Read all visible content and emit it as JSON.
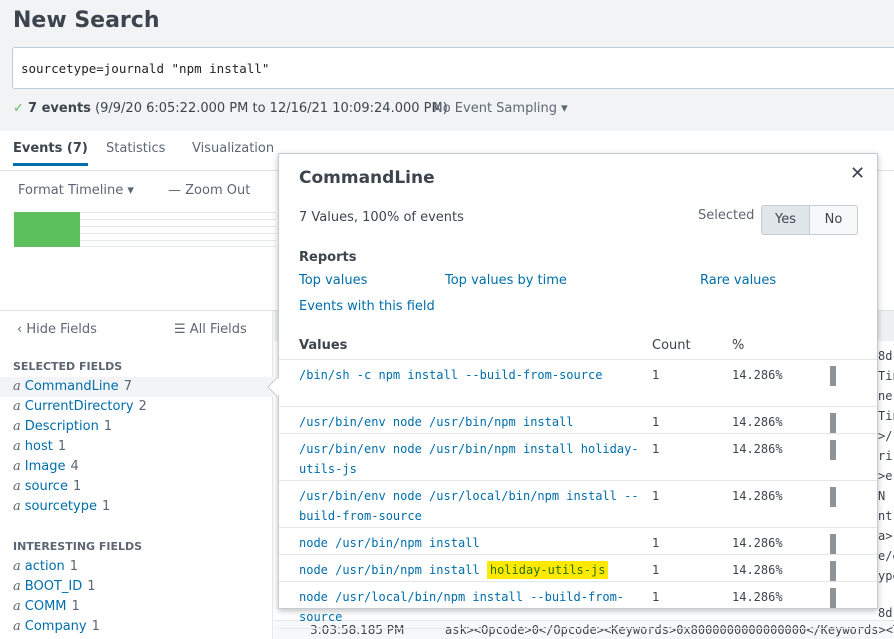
{
  "header": {
    "title": "New Search",
    "query": "sourcetype=journald \"npm install\"",
    "status_count": "7 events",
    "status_range": "(9/9/20 6:05:22.000 PM to 12/16/21 10:09:24.000 PM)",
    "sampling": "No Event Sampling ▾"
  },
  "tabs": [
    {
      "label": "Events (7)",
      "active": true
    },
    {
      "label": "Statistics"
    },
    {
      "label": "Visualization"
    }
  ],
  "timeline": {
    "format": "Format Timeline ▾",
    "zoom_out": "— Zoom Out",
    "bar_color": "#5cc05c"
  },
  "sidebar": {
    "hide": "‹ Hide Fields",
    "all": "☰ All Fields",
    "selected_title": "SELECTED FIELDS",
    "interesting_title": "INTERESTING FIELDS",
    "selected": [
      {
        "name": "CommandLine",
        "count": "7"
      },
      {
        "name": "CurrentDirectory",
        "count": "2"
      },
      {
        "name": "Description",
        "count": "1"
      },
      {
        "name": "host",
        "count": "1"
      },
      {
        "name": "Image",
        "count": "4"
      },
      {
        "name": "source",
        "count": "1"
      },
      {
        "name": "sourcetype",
        "count": "1"
      }
    ],
    "interesting": [
      {
        "name": "action",
        "count": "1"
      },
      {
        "name": "BOOT_ID",
        "count": "1"
      },
      {
        "name": "COMM",
        "count": "1"
      },
      {
        "name": "Company",
        "count": "1"
      }
    ]
  },
  "events": {
    "fragments": [
      "8d",
      "Tin",
      "ne",
      "Tin",
      ">/",
      "ri",
      ">e",
      " N",
      "nt",
      "a>",
      "e/e",
      "ype",
      "8d"
    ],
    "last_time": "3:03:58.185 PM",
    "last_text": "ask><Opcode>0</Opcode><Keywords>0x8000000000000000</Keywords><Ti"
  },
  "popup": {
    "title": "CommandLine",
    "close": "✕",
    "summary": "7 Values, 100% of events",
    "selected_label": "Selected",
    "yes": "Yes",
    "no": "No",
    "reports_title": "Reports",
    "links": [
      "Top values",
      "Top values by time",
      "Rare values",
      "Events with this field"
    ],
    "col_values": "Values",
    "col_count": "Count",
    "col_pct": "%",
    "rows": [
      {
        "value": "/bin/sh -c npm install --build-from-source",
        "count": "1",
        "pct": "14.286%"
      },
      {
        "value": "/usr/bin/env node /usr/bin/npm install",
        "count": "1",
        "pct": "14.286%"
      },
      {
        "value": "/usr/bin/env node /usr/bin/npm install holiday-utils-js",
        "count": "1",
        "pct": "14.286%"
      },
      {
        "value": "/usr/bin/env node /usr/local/bin/npm install --build-from-source",
        "count": "1",
        "pct": "14.286%"
      },
      {
        "value": "node /usr/bin/npm install",
        "count": "1",
        "pct": "14.286%"
      },
      {
        "value": "node /usr/bin/npm install",
        "highlight": "holiday-utils-js",
        "count": "1",
        "pct": "14.286%"
      },
      {
        "value": "node /usr/local/bin/npm install --build-from-source",
        "count": "1",
        "pct": "14.286%"
      }
    ],
    "percent_fraction": 0.14286
  }
}
